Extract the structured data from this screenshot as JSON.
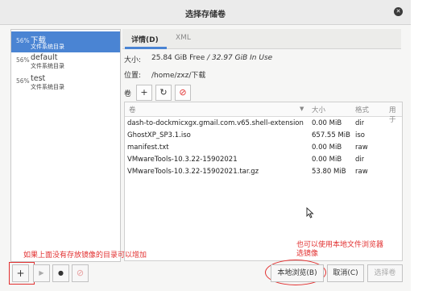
{
  "window": {
    "title": "选择存储卷"
  },
  "pools": [
    {
      "percent": "56%",
      "name": "下载",
      "type": "文件系统目录"
    },
    {
      "percent": "56%",
      "name": "default",
      "type": "文件系统目录"
    },
    {
      "percent": "56%",
      "name": "test",
      "type": "文件系统目录"
    }
  ],
  "tabs": [
    {
      "label": "详情(D)",
      "active": true
    },
    {
      "label": "XML",
      "active": false
    }
  ],
  "info": {
    "size_label": "大小:",
    "size_free": "25.84 GiB Free",
    "size_sep": " / ",
    "size_in_use": "32.97 GiB In Use",
    "location_label": "位置:",
    "location_value": "/home/zxz/下载",
    "volumes_label": "卷"
  },
  "volume_toolbar": {
    "add": "+",
    "refresh": "↻",
    "delete": "⊘"
  },
  "table": {
    "columns": [
      "卷",
      "大小",
      "格式",
      "用于"
    ],
    "rows": [
      {
        "name": "dash-to-dockmicxgx.gmail.com.v65.shell-extension",
        "size": "0.00 MiB",
        "format": "dir"
      },
      {
        "name": "GhostXP_SP3.1.iso",
        "size": "657.55 MiB",
        "format": "iso"
      },
      {
        "name": "manifest.txt",
        "size": "0.00 MiB",
        "format": "raw"
      },
      {
        "name": "VMwareTools-10.3.22-15902021",
        "size": "0.00 MiB",
        "format": "dir"
      },
      {
        "name": "VMwareTools-10.3.22-15902021.tar.gz",
        "size": "53.80 MiB",
        "format": "raw"
      }
    ]
  },
  "bottom": {
    "add_pool": "+",
    "start_pool": "▶",
    "stop_pool": "●",
    "delete_pool": "⊘",
    "browse_local": "本地浏览(B)",
    "cancel": "取消(C)",
    "choose_volume": "选择卷"
  },
  "annotations": {
    "note_left": "如果上面没有存放镜像的目录可以增加",
    "note_right_1": "也可以使用本地文件浏览器",
    "note_right_2": "选镜像"
  },
  "colors": {
    "accent": "#4a84d3",
    "annotation": "#e23030"
  }
}
